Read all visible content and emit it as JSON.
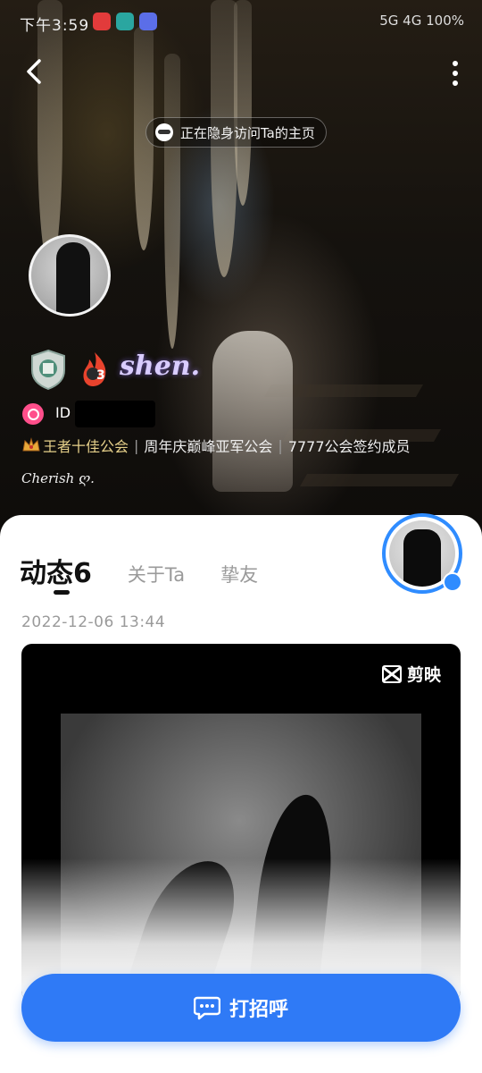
{
  "status_bar": {
    "time": "下午3:59",
    "right_text": "5G 4G 100%"
  },
  "top_bar": {
    "incognito_banner": "正在隐身访问Ta的主页"
  },
  "profile": {
    "nickname": "shen.",
    "level_badge": "3",
    "id_label": "ID",
    "guild_primary": "王者十佳公会",
    "guild_secondary": "周年庆巅峰亚军公会",
    "guild_tertiary": "7777公会签约成员",
    "signature": "Cherish ღ."
  },
  "tabs": [
    {
      "label": "动态",
      "count": "6",
      "active": true
    },
    {
      "label": "关于Ta",
      "active": false
    },
    {
      "label": "挚友",
      "active": false
    }
  ],
  "post": {
    "date": "2022-12-06   13:44",
    "watermark": "剪映"
  },
  "cta": {
    "label": "打招呼"
  },
  "colors": {
    "accent": "#2f7af6",
    "nickname": "#d9ccff",
    "guild_gold": "#e6d08a",
    "gender_pink": "#ff4f8b"
  }
}
